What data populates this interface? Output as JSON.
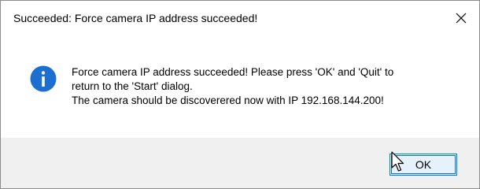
{
  "dialog": {
    "title": "Succeeded: Force camera IP address succeeded!",
    "close_icon": "close-icon",
    "info_icon": "information-icon",
    "message_lines": [
      "Force camera IP address succeeded! Please press 'OK' and 'Quit' to",
      "return to the 'Start' dialog.",
      "The camera should be discoverered now with IP 192.168.144.200!"
    ],
    "ok_label": "OK"
  },
  "colors": {
    "info_icon_blue": "#1c6fd0",
    "button_border": "#0078d7",
    "button_fill": "#e5f1fb",
    "footer_bg": "#f0f0f0"
  }
}
